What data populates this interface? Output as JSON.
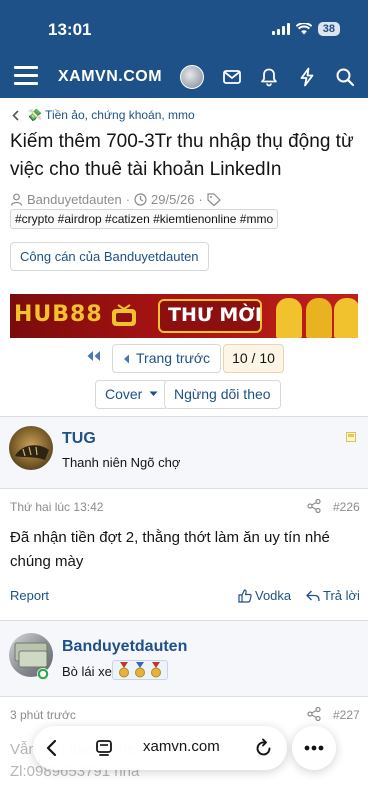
{
  "status_bar": {
    "time": "13:01",
    "battery": "38"
  },
  "header": {
    "logo": "XAMVN.COM"
  },
  "breadcrumb": {
    "label": "💸 Tiền ảo, chứng khoán, mmo"
  },
  "thread": {
    "title": "Kiếm thêm 700-3Tr thu nhập thụ động từ việc cho thuê tài khoản LinkedIn",
    "author": "Banduyetdauten",
    "date": "29/5/26",
    "tags": "#crypto #airdrop #catizen #kiemtienonline #mmo",
    "tools_label": "Công cán của Banduyetdauten"
  },
  "banner": {
    "brand": "HUB88",
    "cta": "THƯ MỜI"
  },
  "pager": {
    "prev_label": "Trang trước",
    "indicator": "10 / 10"
  },
  "thread_actions": {
    "cover_label": "Cover",
    "unwatch_label": "Ngừng dõi theo"
  },
  "posts": [
    {
      "username": "TUG",
      "user_title": "Thanh niên Ngõ chợ",
      "time": "Thứ hai lúc 13:42",
      "number": "#226",
      "body": "Đã nhận tiền đợt 2, thằng thớt làm ăn uy tín nhé chúng mày",
      "report_label": "Report",
      "vodka_label": "Vodka",
      "reply_label": "Trả lời"
    },
    {
      "username": "Banduyetdauten",
      "user_title": "Bò lái xe",
      "time": "3 phút trước",
      "number": "#227",
      "preview_line1": "Vẫn còn tuyển nhé",
      "preview_line2": "Zl:0989653791 nha"
    }
  ],
  "browser": {
    "url": "xamvn.com"
  },
  "colors": {
    "brand": "#1e5187",
    "link": "#1e5187",
    "muted": "#8c8c8c"
  }
}
